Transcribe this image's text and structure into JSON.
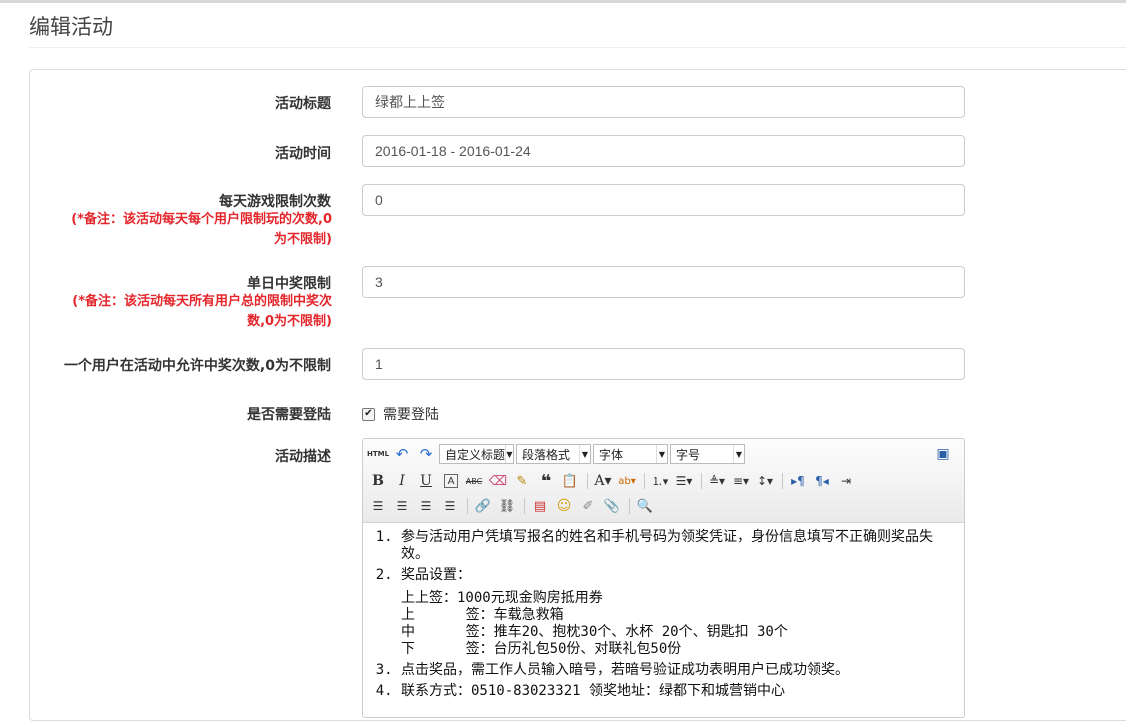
{
  "page": {
    "title": "编辑活动"
  },
  "form": {
    "title": {
      "label": "活动标题",
      "value": "绿都上上签"
    },
    "time": {
      "label": "活动时间",
      "value": "2016-01-18 - 2016-01-24"
    },
    "daily_limit": {
      "label": "每天游戏限制次数",
      "note_line1": "(*备注：该活动每天每个用户限制玩的次数,0",
      "note_line2": "为不限制)",
      "value": "0"
    },
    "daily_win_limit": {
      "label": "单日中奖限制",
      "note_line1": "(*备注：该活动每天所有用户总的限制中奖次",
      "note_line2": "数,0为不限制)",
      "value": "3"
    },
    "user_win_limit": {
      "label": "一个用户在活动中允许中奖次数,0为不限制",
      "value": "1"
    },
    "login": {
      "label": "是否需要登陆",
      "checkbox_label": "需要登陆",
      "checked": true
    },
    "description": {
      "label": "活动描述"
    }
  },
  "editor": {
    "combos": {
      "custom_title": "自定义标题",
      "paragraph": "段落格式",
      "font": "字体",
      "size": "字号"
    },
    "items": [
      {
        "num": "1.",
        "text": "参与活动用户凭填写报名的姓名和手机号码为领奖凭证，身份信息填写不正确则奖品失效。"
      },
      {
        "num": "2.",
        "text": "奖品设置："
      },
      {
        "num": "3.",
        "text": "点击奖品，需工作人员输入暗号，若暗号验证成功表明用户已成功领奖。"
      },
      {
        "num": "4.",
        "text": "联系方式：0510-83023321 领奖地址：绿都下和城营销中心"
      }
    ],
    "prizes": [
      "上上签：1000元现金购房抵用券",
      "上      签：车载急救箱",
      "中      签：推车20、抱枕30个、水杯 20个、钥匙扣 30个",
      "下      签：台历礼包50份、对联礼包50份"
    ]
  },
  "colors": {
    "note_red": "#e4262b",
    "border": "#cccccc"
  }
}
